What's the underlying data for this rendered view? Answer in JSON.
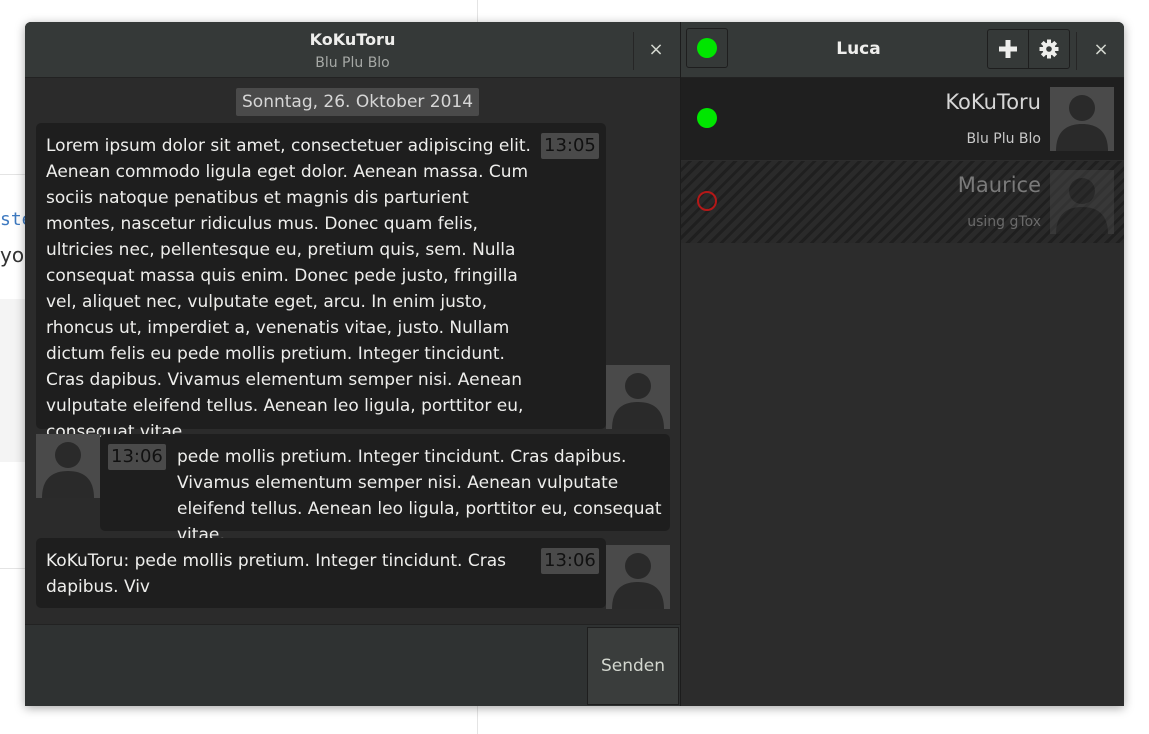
{
  "background": {
    "code_fragment": "ste",
    "text_fragment": "you"
  },
  "chat": {
    "contact_name": "KoKuToru",
    "contact_status": "Blu Plu Blo",
    "close_label": "×",
    "date_separator": "Sonntag, 26. Oktober 2014",
    "messages": [
      {
        "time": "13:05",
        "direction": "outgoing",
        "text": "Lorem ipsum dolor sit amet, consectetuer adipiscing elit. Aenean commodo ligula eget dolor. Aenean massa. Cum sociis natoque penatibus et magnis dis parturient montes, nascetur ridiculus mus. Donec quam felis, ultricies nec, pellentesque eu, pretium quis, sem. Nulla consequat massa quis enim. Donec pede justo, fringilla vel, aliquet nec, vulputate eget, arcu. In enim justo, rhoncus ut, imperdiet a, venenatis vitae, justo. Nullam dictum felis eu pede mollis pretium. Integer tincidunt. Cras dapibus. Vivamus elementum semper nisi. Aenean vulputate eleifend tellus. Aenean leo ligula, porttitor eu, consequat vitae,"
      },
      {
        "time": "13:06",
        "direction": "incoming",
        "text": "pede mollis pretium. Integer tincidunt. Cras dapibus. Vivamus elementum semper nisi. Aenean vulputate eleifend tellus. Aenean leo ligula, porttitor eu, consequat vitae,"
      },
      {
        "time": "13:06",
        "direction": "outgoing",
        "text": "KoKuToru: pede mollis pretium. Integer tincidunt. Cras dapibus. Viv"
      }
    ],
    "input": {
      "value": "",
      "send_label": "Senden"
    }
  },
  "contacts": {
    "user_name": "Luca",
    "close_label": "×",
    "icons": {
      "status": "online-status-icon",
      "add": "plus-icon",
      "settings": "gear-icon"
    },
    "list": [
      {
        "name": "KoKuToru",
        "status": "Blu Plu Blo",
        "online": true
      },
      {
        "name": "Maurice",
        "status": "using gTox",
        "online": false
      }
    ]
  },
  "colors": {
    "online": "#00e600",
    "offline": "#b41818",
    "window_bg": "#2b2b2b",
    "header_bg": "#353938"
  }
}
